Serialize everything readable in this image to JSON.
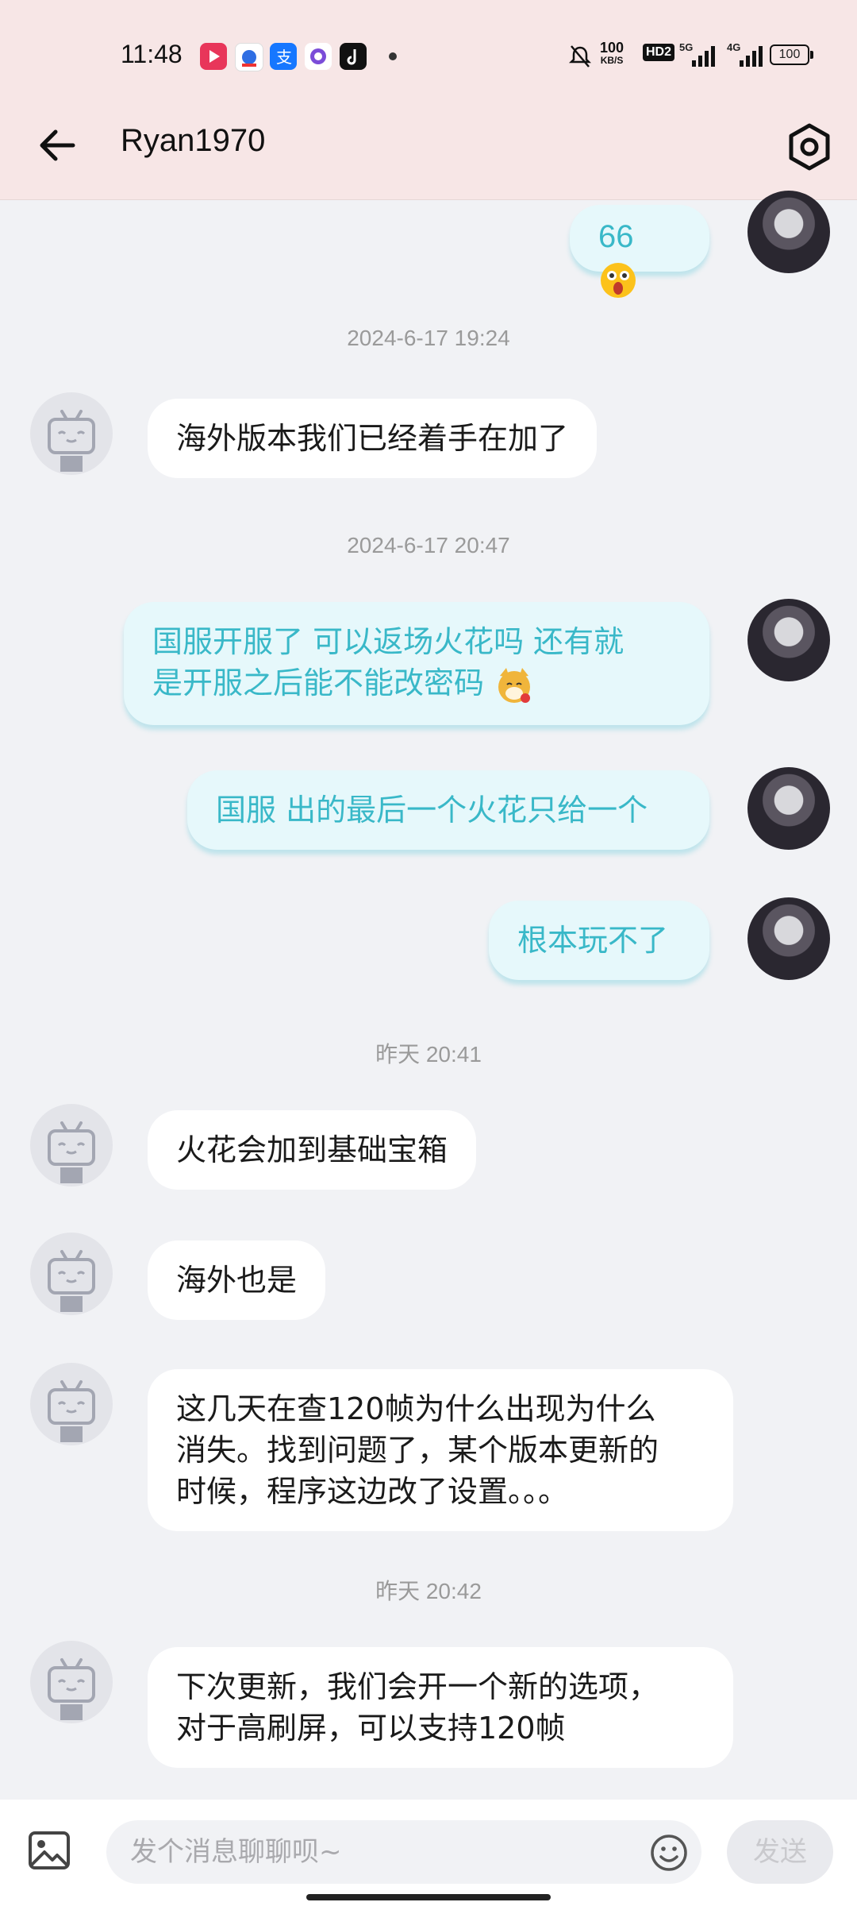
{
  "status_bar": {
    "time": "11:48",
    "net_speed_value": "100",
    "net_speed_unit": "KB/S",
    "hd_badge": "HD2",
    "signal1_label": "5G",
    "signal2_label": "4G",
    "battery": "100",
    "icons": [
      "video-app-icon",
      "baidu-app-icon",
      "alipay-app-icon",
      "chat-app-icon",
      "tiktok-app-icon",
      "more-dot-icon",
      "mute-bell-icon",
      "signal-5g-icon",
      "signal-4g-icon",
      "battery-icon"
    ]
  },
  "header": {
    "title": "Ryan1970",
    "back_icon": "arrow-left-icon",
    "settings_icon": "gear-icon"
  },
  "messages": [
    {
      "side": "right",
      "text": "66"
    },
    {
      "timestamp": "2024-6-17 19:24"
    },
    {
      "side": "left",
      "text": "海外版本我们已经着手在加了"
    },
    {
      "timestamp": "2024-6-17 20:47"
    },
    {
      "side": "right",
      "lines": [
        "国服开服了 可以返场火花吗 还有就",
        "是开服之后能不能改密码"
      ]
    },
    {
      "side": "right",
      "text": "国服 出的最后一个火花只给一个"
    },
    {
      "side": "right",
      "text": "根本玩不了"
    },
    {
      "timestamp": "昨天 20:41"
    },
    {
      "side": "left",
      "text": "火花会加到基础宝箱"
    },
    {
      "side": "left",
      "text": "海外也是"
    },
    {
      "side": "left",
      "lines": [
        "这几天在查120帧为什么出现为什么",
        "消失。找到问题了，某个版本更新的",
        "时候，程序这边改了设置。。。"
      ]
    },
    {
      "timestamp": "昨天 20:42"
    },
    {
      "side": "left",
      "lines": [
        "下次更新，我们会开一个新的选项，",
        "对于高刷屏，可以支持120帧"
      ]
    }
  ],
  "composer": {
    "placeholder": "发个消息聊聊呗~",
    "send_label": "发送"
  },
  "colors": {
    "header_bg": "#f7e6e6",
    "chat_bg": "#f1f2f5",
    "right_bubble_bg": "#e6f8fb",
    "right_bubble_text": "#39b8c8"
  }
}
